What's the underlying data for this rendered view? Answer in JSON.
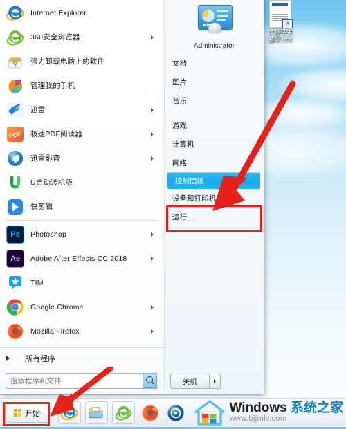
{
  "desktop": {
    "icons": [
      {
        "name": "word-document",
        "label_line1": "计算基金",
        "label_line2": "益率.doc",
        "badge": "W"
      }
    ]
  },
  "start_menu": {
    "programs": [
      {
        "label": "Internet Explorer",
        "icon": "internet-explorer-icon",
        "has_submenu": false
      },
      {
        "label": "360安全浏览器",
        "icon": "360-browser-icon",
        "has_submenu": true
      },
      {
        "label": "强力卸载电脑上的软件",
        "icon": "uninstall-tool-icon",
        "has_submenu": false
      },
      {
        "label": "管理我的手机",
        "icon": "phone-manager-icon",
        "has_submenu": false
      },
      {
        "label": "迅雷",
        "icon": "thunder-icon",
        "has_submenu": true
      },
      {
        "label": "极速PDF阅读器",
        "icon": "pdf-reader-icon",
        "has_submenu": true
      },
      {
        "label": "迅雷影音",
        "icon": "thunder-player-icon",
        "has_submenu": true
      },
      {
        "label": "U启动装机版",
        "icon": "uqidong-icon",
        "has_submenu": false
      },
      {
        "label": "快剪辑",
        "icon": "kuaijianji-icon",
        "has_submenu": false
      }
    ],
    "programs_pinned": [
      {
        "label": "Photoshop",
        "icon": "photoshop-icon",
        "has_submenu": true
      },
      {
        "label": "Adobe After Effects CC 2018",
        "icon": "after-effects-icon",
        "has_submenu": true
      },
      {
        "label": "TIM",
        "icon": "tim-icon",
        "has_submenu": false
      },
      {
        "label": "Google Chrome",
        "icon": "chrome-icon",
        "has_submenu": true
      },
      {
        "label": "Mozilla Firefox",
        "icon": "firefox-icon",
        "has_submenu": true
      }
    ],
    "all_programs_label": "所有程序",
    "search": {
      "placeholder": "搜索程序和文件",
      "value": "",
      "icon": "search-icon"
    },
    "right_panel": {
      "user_name": "Administrator",
      "user_picture_icon": "user-account-picture",
      "group1": [
        {
          "label": "文档",
          "selected": false
        },
        {
          "label": "图片",
          "selected": false
        },
        {
          "label": "音乐",
          "selected": false
        }
      ],
      "group2": [
        {
          "label": "游戏",
          "selected": false
        },
        {
          "label": "计算机",
          "selected": false
        },
        {
          "label": "网络",
          "selected": false
        },
        {
          "label": "控制面板",
          "selected": true
        },
        {
          "label": "设备和打印机",
          "selected": false
        },
        {
          "label": "运行...",
          "selected": false
        }
      ],
      "shutdown_label": "关机",
      "shutdown_more_icon": "chevron-right-icon"
    }
  },
  "taskbar": {
    "start_label": "开始",
    "start_icon": "windows-flag-icon",
    "pinned": [
      {
        "name": "internet-explorer-icon"
      },
      {
        "name": "windows-explorer-icon"
      },
      {
        "name": "360-browser-icon"
      },
      {
        "name": "firefox-icon"
      },
      {
        "name": "360-security-icon"
      }
    ]
  },
  "watermark": {
    "title_en": "Windows ",
    "title_cn": "系统之家",
    "url": "www.bjjmlv.com",
    "logo_icon": "house-windows-logo"
  },
  "annotations": {
    "highlight_color": "#e8201a",
    "selection_color": "#1ba9ea",
    "boxes": [
      {
        "target": "控制面板"
      },
      {
        "target": "开始"
      }
    ]
  }
}
